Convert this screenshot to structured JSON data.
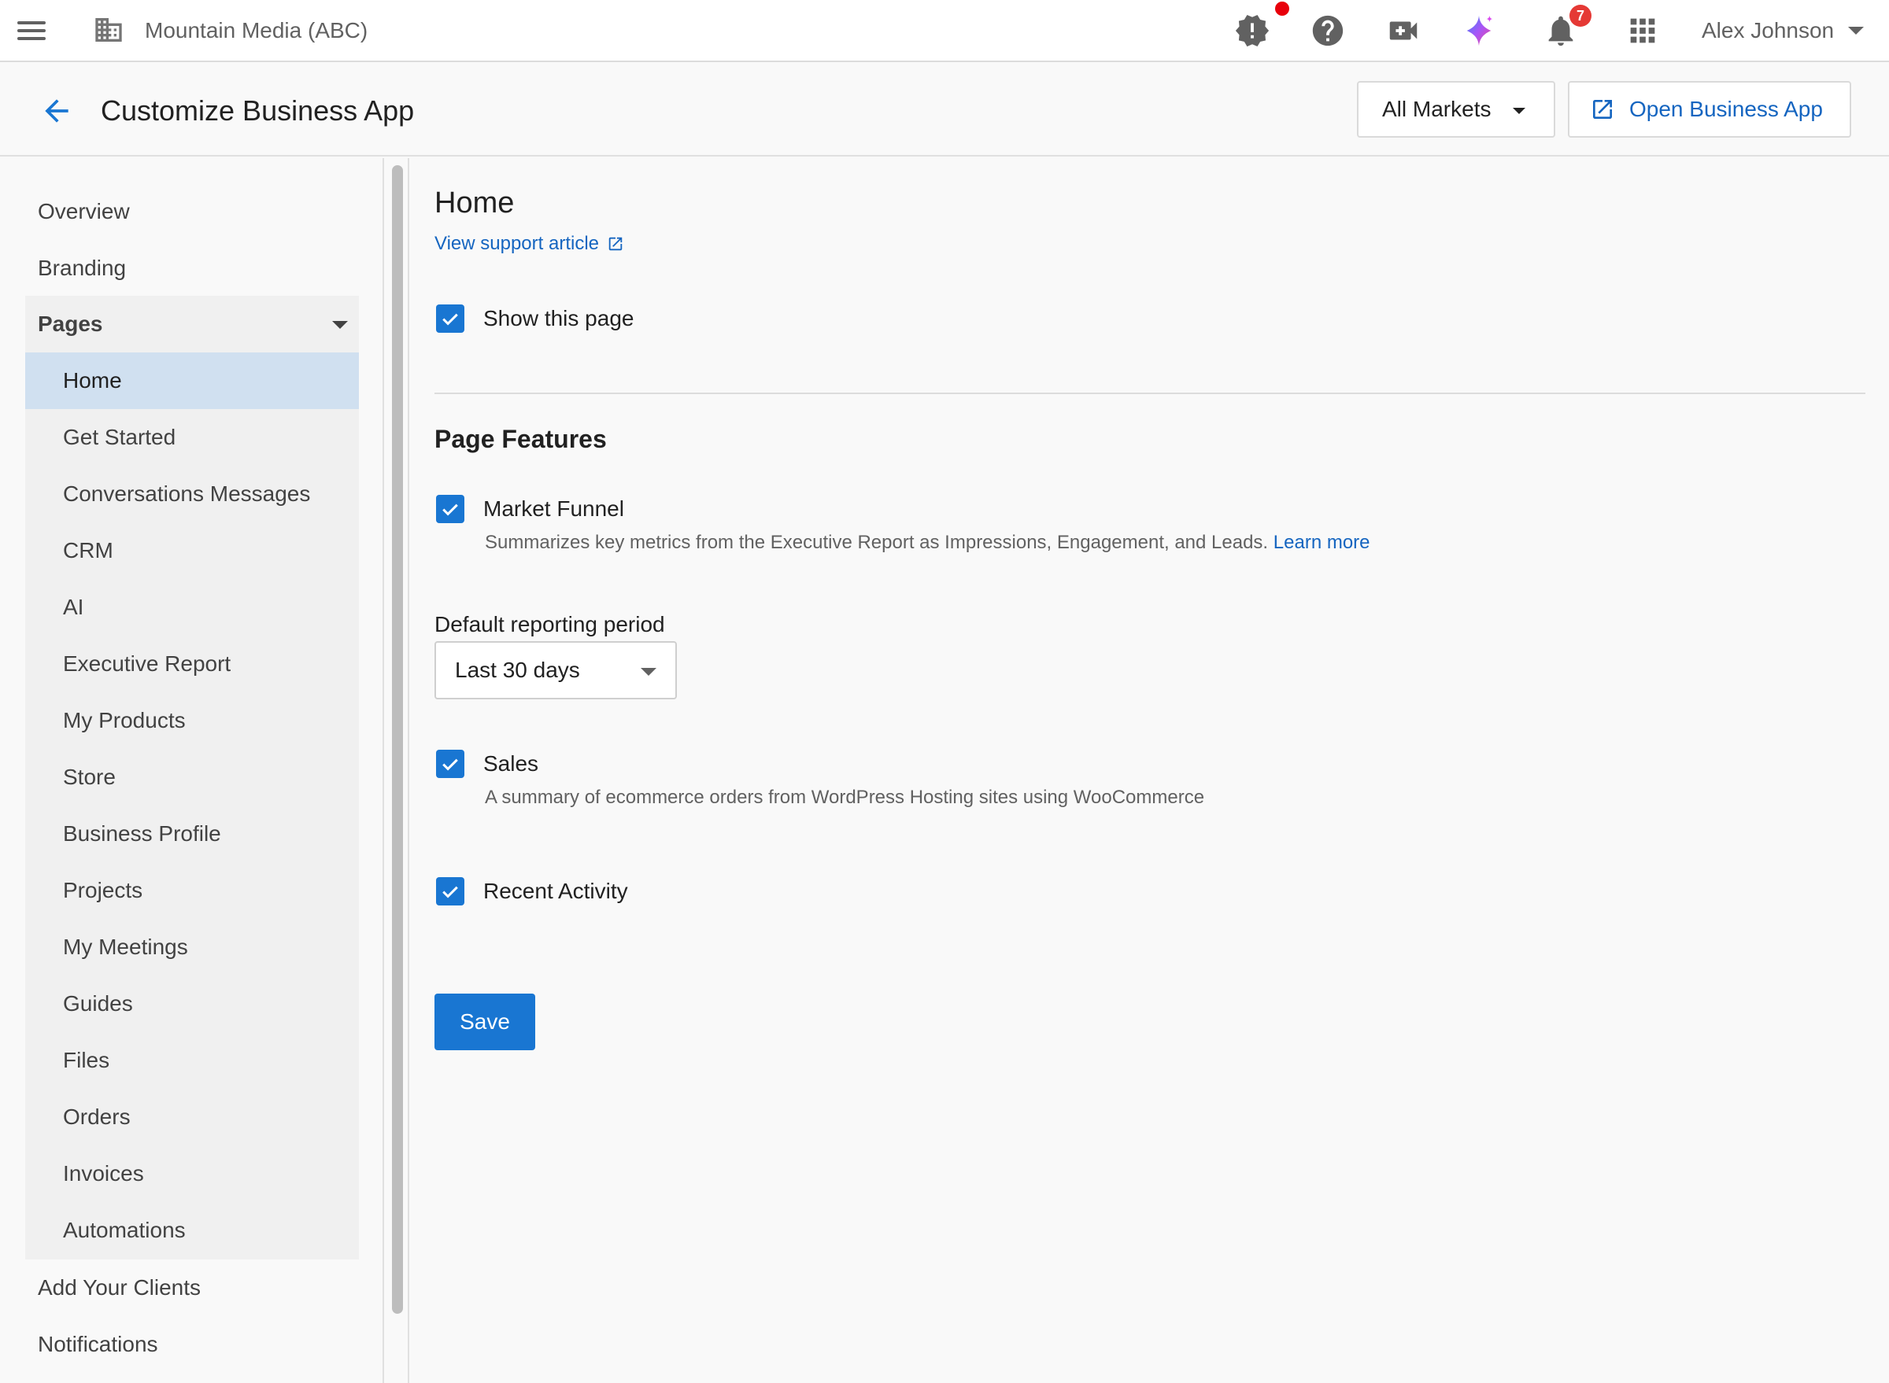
{
  "topbar": {
    "org_name": "Mountain Media (ABC)",
    "user_name": "Alex Johnson",
    "notification_count": "7",
    "icons": [
      "menu-icon",
      "building-icon",
      "alert-badge-icon",
      "help-icon",
      "video-call-icon",
      "ai-sparkle-icon",
      "bell-icon",
      "apps-grid-icon"
    ]
  },
  "header": {
    "title": "Customize Business App",
    "markets_label": "All Markets",
    "open_app_label": "Open Business App"
  },
  "sidebar": {
    "top_items": [
      {
        "label": "Overview"
      },
      {
        "label": "Branding"
      }
    ],
    "pages_label": "Pages",
    "pages_items": [
      {
        "label": "Home"
      },
      {
        "label": "Get Started"
      },
      {
        "label": "Conversations Messages"
      },
      {
        "label": "CRM"
      },
      {
        "label": "AI"
      },
      {
        "label": "Executive Report"
      },
      {
        "label": "My Products"
      },
      {
        "label": "Store"
      },
      {
        "label": "Business Profile"
      },
      {
        "label": "Projects"
      },
      {
        "label": "My Meetings"
      },
      {
        "label": "Guides"
      },
      {
        "label": "Files"
      },
      {
        "label": "Orders"
      },
      {
        "label": "Invoices"
      },
      {
        "label": "Automations"
      }
    ],
    "bottom_items": [
      {
        "label": "Add Your Clients"
      },
      {
        "label": "Notifications"
      }
    ]
  },
  "main": {
    "title": "Home",
    "support_link": "View support article",
    "show_page_label": "Show this page",
    "features_title": "Page Features",
    "market_funnel": {
      "label": "Market Funnel",
      "description": "Summarizes key metrics from the Executive Report as Impressions, Engagement, and Leads.",
      "learn_more": "Learn more"
    },
    "period": {
      "label": "Default reporting period",
      "value": "Last 30 days"
    },
    "sales": {
      "label": "Sales",
      "description": "A summary of ecommerce orders from WordPress Hosting sites using WooCommerce"
    },
    "recent_activity": {
      "label": "Recent Activity"
    },
    "save_label": "Save"
  },
  "colors": {
    "accent": "#1976d2",
    "link": "#1565c0",
    "active_nav": "#d0e0f0",
    "badge": "#e53935"
  }
}
